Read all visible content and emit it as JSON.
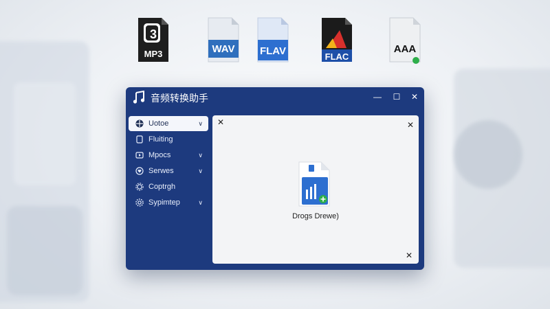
{
  "formats": [
    {
      "name": "mp3",
      "label": "MP3",
      "glyph": "3",
      "colors": {
        "body": "#1e1e1e",
        "text": "#ffffff"
      }
    },
    {
      "name": "wav",
      "label": "WAV",
      "colors": {
        "body": "#e7ebf1",
        "band": "#2f6fbd",
        "text": "#ffffff"
      }
    },
    {
      "name": "flav",
      "label": "FLAV",
      "colors": {
        "body": "#dfe8f6",
        "band": "#2d6fd0",
        "text": "#ffffff"
      }
    },
    {
      "name": "flac",
      "label": "FLAC",
      "colors": {
        "body": "#1b1b1b",
        "band": "#1d4fa8",
        "accent_red": "#d8302c",
        "accent_yellow": "#f2b21a",
        "text": "#ffffff"
      }
    },
    {
      "name": "aaa",
      "label": "AAA",
      "colors": {
        "body": "#eef0f2",
        "text": "#111111",
        "badge": "#2eae4a"
      }
    }
  ],
  "window": {
    "title": "音频转换助手",
    "icon": "music-note-icon",
    "controls": {
      "minimize": "—",
      "maximize": "☐",
      "close": "✕"
    },
    "sidebar": {
      "items": [
        {
          "label": "Uotoe",
          "icon": "grid-icon",
          "chevron": "∨",
          "active": true
        },
        {
          "label": "Fluiting",
          "icon": "document-icon",
          "chevron": ""
        },
        {
          "label": "Mpocs",
          "icon": "play-icon",
          "chevron": "∨"
        },
        {
          "label": "Serwes",
          "icon": "heart-icon",
          "chevron": "∨"
        },
        {
          "label": "Coptrgh",
          "icon": "gear-icon",
          "chevron": ""
        },
        {
          "label": "Sypimtep",
          "icon": "settings-cog-icon",
          "chevron": "∨"
        }
      ]
    },
    "panel": {
      "close_glyph": "✕",
      "drop_label": "Drogs Drewe)",
      "drop_icon": "audio-file-add-icon"
    }
  },
  "colors": {
    "window_bg": "#1d3a7e",
    "panel_bg": "#f3f4f6",
    "accent_blue": "#2d6fd0",
    "accent_green": "#2eae4a"
  }
}
